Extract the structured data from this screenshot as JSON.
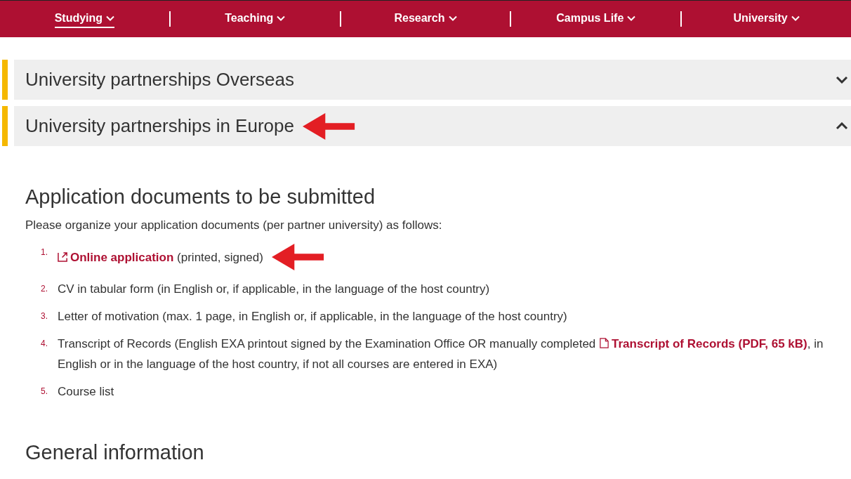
{
  "nav": [
    {
      "label": "Studying",
      "selected": true
    },
    {
      "label": "Teaching",
      "selected": false
    },
    {
      "label": "Research",
      "selected": false
    },
    {
      "label": "Campus Life",
      "selected": false
    },
    {
      "label": "University",
      "selected": false
    }
  ],
  "accordions": [
    {
      "title": "University partnerships Overseas",
      "expanded": false,
      "marked": false
    },
    {
      "title": "University partnerships in Europe",
      "expanded": true,
      "marked": true
    }
  ],
  "sections": [
    {
      "heading": "Application documents to be submitted",
      "intro": "Please organize your application documents (per partner university) as follows:",
      "items": [
        {
          "number": "1.",
          "marked": true,
          "parts": [
            {
              "kind": "external_link",
              "text": "Online application"
            },
            {
              "kind": "text",
              "text": " (printed, signed)"
            }
          ]
        },
        {
          "number": "2.",
          "marked": false,
          "parts": [
            {
              "kind": "text",
              "text": "CV in tabular form (in English or, if applicable, in the language of the host country)"
            }
          ]
        },
        {
          "number": "3.",
          "marked": false,
          "parts": [
            {
              "kind": "text",
              "text": "Letter of motivation (max. 1 page, in English or, if applicable, in the language of the host country)"
            }
          ]
        },
        {
          "number": "4.",
          "marked": false,
          "parts": [
            {
              "kind": "text",
              "text": "Transcript of Records (English EXA printout signed by the Examination Office OR manually completed "
            },
            {
              "kind": "file_link",
              "text": "Transcript of Records (PDF, 65 kB)"
            },
            {
              "kind": "text",
              "text": ", in English or in the language of the host country, if not all courses are entered in EXA)"
            }
          ]
        },
        {
          "number": "5.",
          "marked": false,
          "parts": [
            {
              "kind": "text",
              "text": "Course list"
            }
          ]
        }
      ]
    },
    {
      "heading": "General information"
    }
  ]
}
